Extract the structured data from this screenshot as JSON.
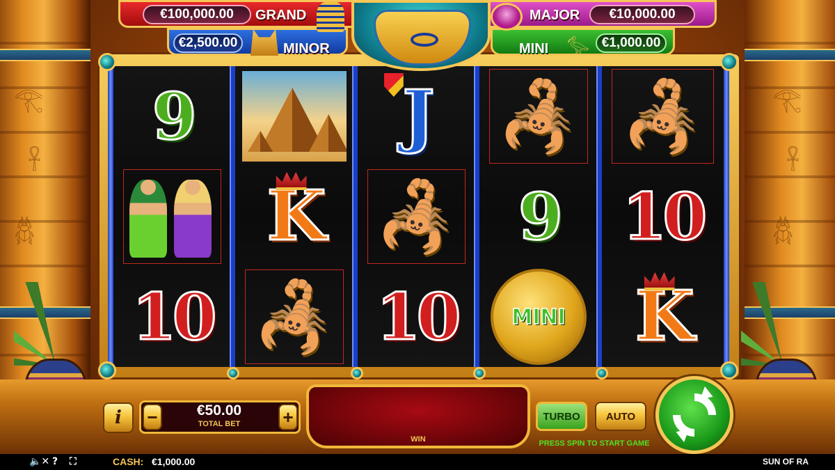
{
  "jackpots": {
    "grand": {
      "label": "GRAND",
      "amount": "€100,000.00"
    },
    "major": {
      "label": "MAJOR",
      "amount": "€10,000.00"
    },
    "minor": {
      "label": "MINOR",
      "amount": "€2,500.00"
    },
    "mini": {
      "label": "MINI",
      "amount": "€1,000.00"
    }
  },
  "reels": [
    [
      {
        "type": "9",
        "text": "9"
      },
      {
        "type": "dancers",
        "text": ""
      },
      {
        "type": "10",
        "text": "10"
      }
    ],
    [
      {
        "type": "pyramids",
        "text": ""
      },
      {
        "type": "K",
        "text": "K"
      },
      {
        "type": "scorpion",
        "text": ""
      }
    ],
    [
      {
        "type": "J",
        "text": "J"
      },
      {
        "type": "scorpion",
        "text": ""
      },
      {
        "type": "10",
        "text": "10"
      }
    ],
    [
      {
        "type": "scorpion",
        "text": ""
      },
      {
        "type": "9",
        "text": "9"
      },
      {
        "type": "mini-coin",
        "text": "MINI"
      }
    ],
    [
      {
        "type": "scorpion",
        "text": ""
      },
      {
        "type": "10",
        "text": "10"
      },
      {
        "type": "K",
        "text": "K"
      }
    ]
  ],
  "controls": {
    "info_label": "i",
    "bet_minus": "−",
    "bet_plus": "+",
    "bet_value": "€50.00",
    "bet_label": "TOTAL BET",
    "win_label": "WIN",
    "turbo_label": "TURBO",
    "auto_label": "AUTO",
    "press_spin": "PRESS SPIN TO START GAME"
  },
  "status_bar": {
    "sound_icon": "sound-muted-icon",
    "help_icon": "help-icon",
    "fullscreen_icon": "fullscreen-icon",
    "cash_label": "CASH:",
    "cash_value": "€1,000.00",
    "game_name": "SUN OF RA"
  },
  "colors": {
    "grand": "#c8181a",
    "major": "#c02aa8",
    "minor": "#1e50c8",
    "mini": "#24a020",
    "reel_divider": "#1a3fc9",
    "spin": "#1a9a1a"
  }
}
